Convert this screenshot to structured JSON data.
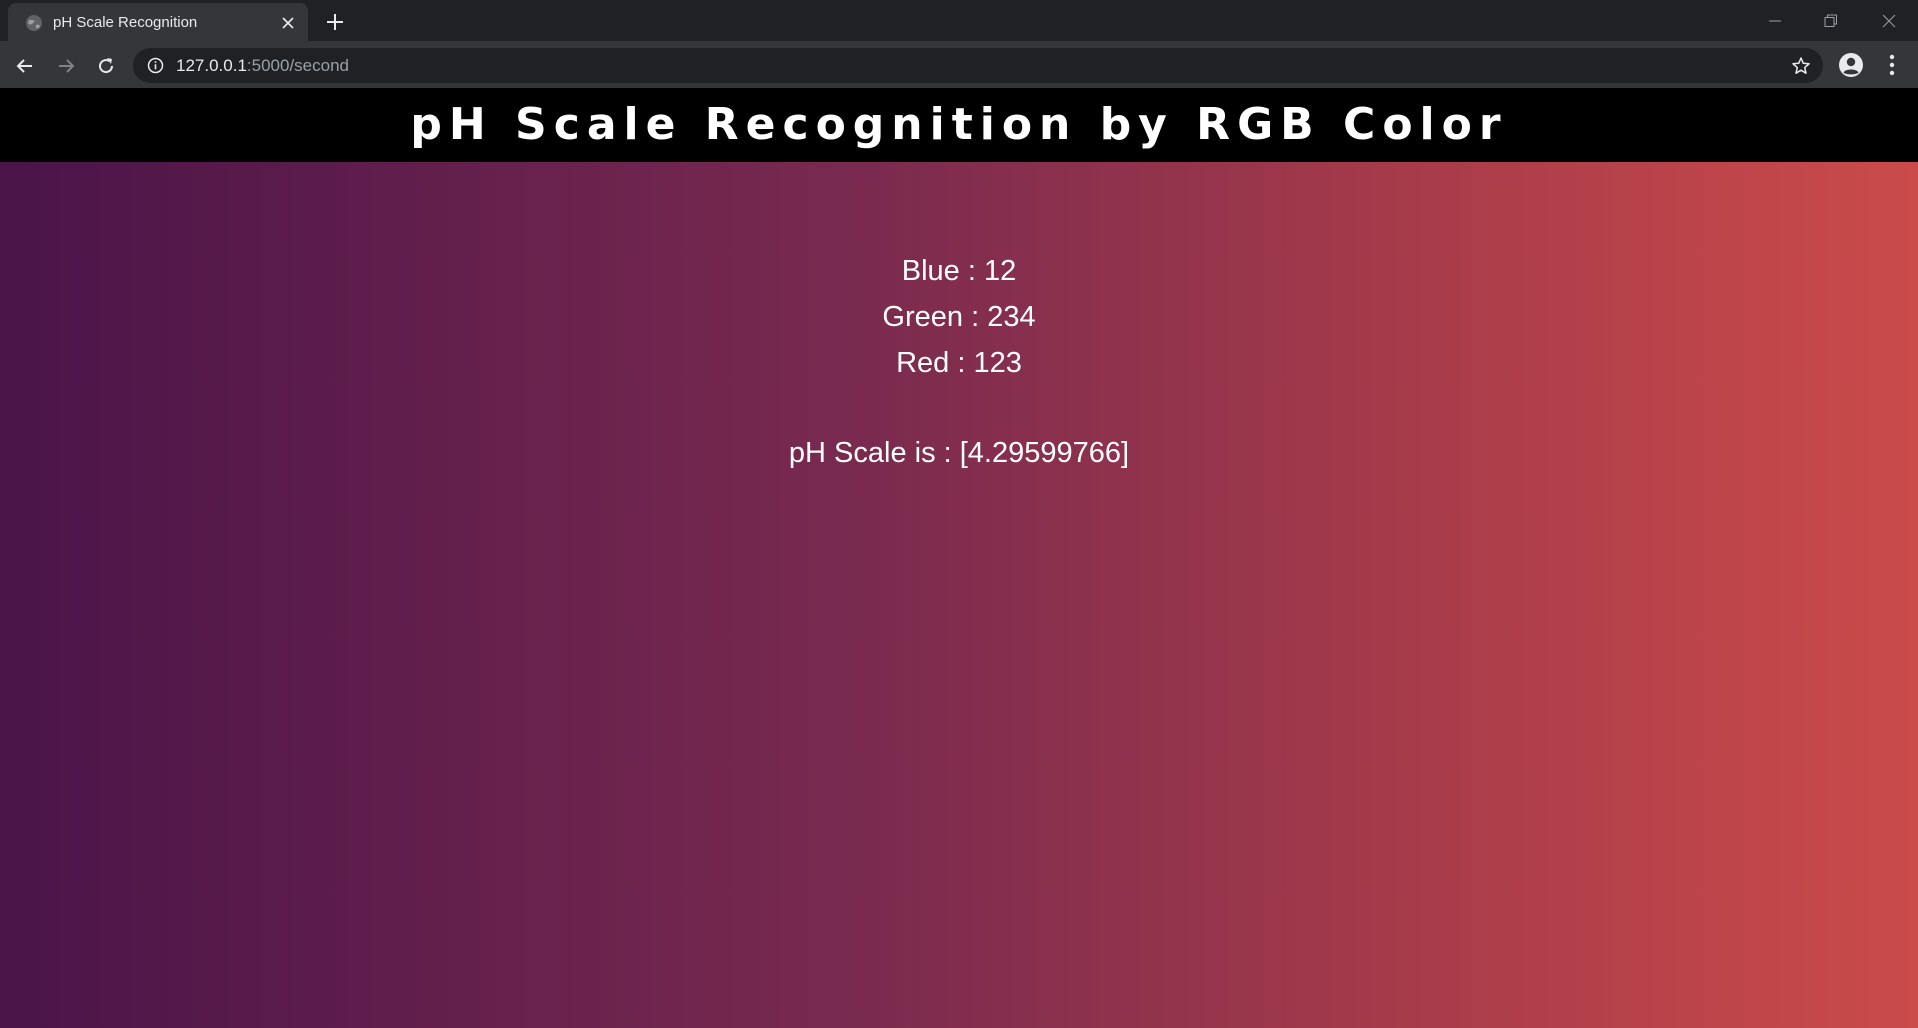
{
  "browser": {
    "tab_title": "pH Scale Recognition",
    "url_host": "127.0.0.1",
    "url_path": ":5000/second",
    "new_tab_label": "+",
    "close_tab_label": "✕"
  },
  "header": {
    "title": "pH Scale Recognition by RGB Color"
  },
  "readings": {
    "blue": "Blue : 12",
    "green": "Green : 234",
    "red": "Red : 123"
  },
  "result": {
    "ph_text": "pH Scale is : [4.29599766]"
  },
  "colors": {
    "header_bg": "#000000",
    "gradient_left": "#4a1449",
    "gradient_right": "#cb4b4a",
    "text": "#ffffff"
  },
  "icons": [
    "globe-icon",
    "close-icon",
    "plus-icon",
    "minimize-icon",
    "restore-icon",
    "window-close-icon",
    "back-arrow-icon",
    "forward-arrow-icon",
    "reload-icon",
    "info-icon",
    "star-icon",
    "profile-icon",
    "kebab-menu-icon"
  ]
}
